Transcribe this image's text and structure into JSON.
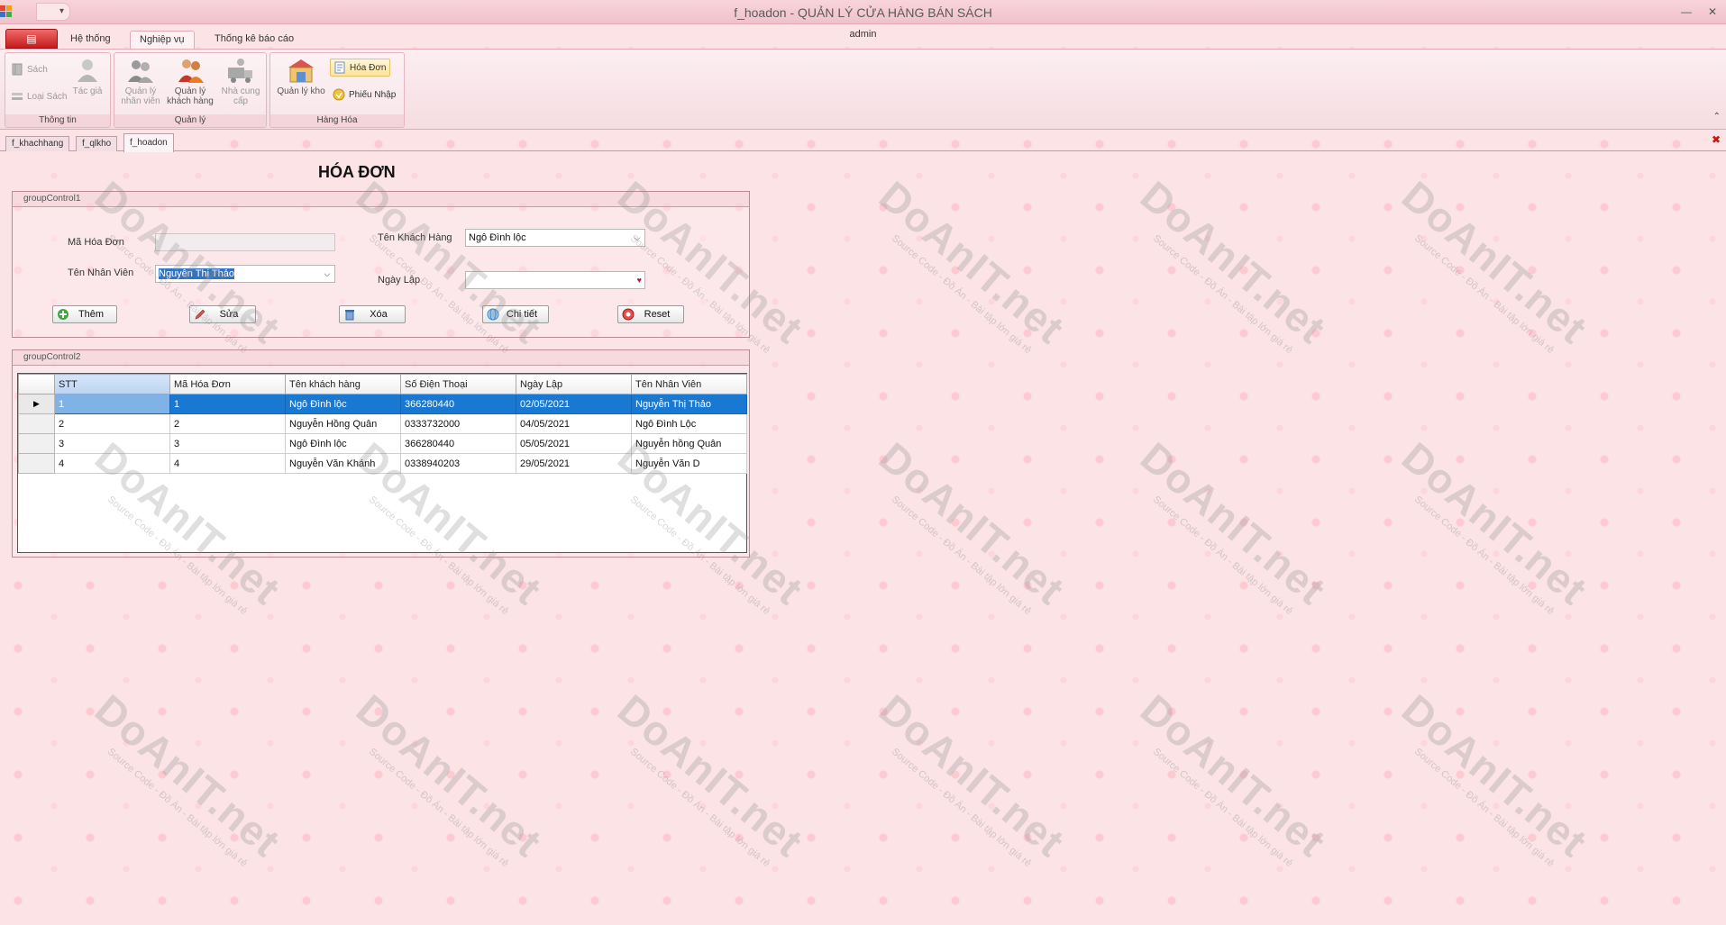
{
  "window": {
    "title": "f_hoadon - QUẢN LÝ CỬA HÀNG BÁN SÁCH",
    "user": "admin",
    "qat_glyph": "▾",
    "minimize_glyph": "—",
    "close_glyph": "✕"
  },
  "ribbon": {
    "file_glyph": "▤",
    "tabs": [
      "Hệ thống",
      "Nghiệp vụ",
      "Thống kê báo cáo"
    ],
    "groups": {
      "thong_tin": {
        "label": "Thông tin",
        "sach": "Sách",
        "loai_sach": "Loại Sách",
        "tac_gia": "Tác giả"
      },
      "quan_ly": {
        "label": "Quản lý",
        "nhan_vien": [
          "Quản lý",
          "nhân viên"
        ],
        "khach_hang": [
          "Quản lý",
          "khách hàng"
        ],
        "nha_cung_cap": [
          "Nhà cung",
          "cấp"
        ]
      },
      "hang_hoa": {
        "label": "Hàng Hóa",
        "quan_ly_kho": "Quản lý kho",
        "hoa_don": "Hóa Đơn",
        "phieu_nhap": "Phiếu Nhập"
      }
    },
    "collapse_glyph": "⌃"
  },
  "doc_tabs": [
    "f_khachhang",
    "f_qlkho",
    "f_hoadon"
  ],
  "doc_close_glyph": "✖",
  "form": {
    "title": "HÓA ĐƠN",
    "group1": {
      "header": "groupControl1",
      "ma_hoa_don_label": "Mã Hóa Đơn",
      "ma_hoa_don_value": "",
      "ten_nhan_vien_label": "Tên Nhân Viên",
      "ten_nhan_vien_value": "Nguyễn Thị Thảo",
      "ten_khach_hang_label": "Tên Khách Hàng",
      "ten_khach_hang_value": "Ngô Đình lộc",
      "ngay_lap_label": "Ngày Lập",
      "ngay_lap_value": "",
      "combo_glyph": "⌵",
      "date_glyph": "♥"
    },
    "buttons": {
      "them": "Thêm",
      "sua": "Sửa",
      "xoa": "Xóa",
      "chi_tiet": "Chi tiết",
      "reset": "Reset"
    },
    "group2": {
      "header": "groupControl2"
    },
    "grid": {
      "columns": [
        "STT",
        "Mã Hóa Đơn",
        "Tên khách hàng",
        "Số Điện Thoại",
        "Ngày Lập",
        "Tên Nhân Viên"
      ],
      "current_row_glyph": "▶",
      "rows": [
        [
          "1",
          "1",
          "Ngô Đình lộc",
          "366280440",
          "02/05/2021",
          "Nguyễn Thị Thảo"
        ],
        [
          "2",
          "2",
          "Nguyễn Hồng Quân",
          "0333732000",
          "04/05/2021",
          "Ngô Đình Lộc"
        ],
        [
          "3",
          "3",
          "Ngô Đình lộc",
          "366280440",
          "05/05/2021",
          "Nguyễn hồng Quân"
        ],
        [
          "4",
          "4",
          "Nguyễn Văn Khánh",
          "0338940203",
          "29/05/2021",
          "Nguyễn Văn D"
        ]
      ]
    }
  },
  "watermark": {
    "text": "DoAnIT.net",
    "sub": "Source Code - Đồ Án - Bài tập lớn giá rẻ"
  },
  "colors": {
    "background": "#fbe3e6",
    "selection": "#1978d2",
    "file_tab": "#c51b1b"
  }
}
